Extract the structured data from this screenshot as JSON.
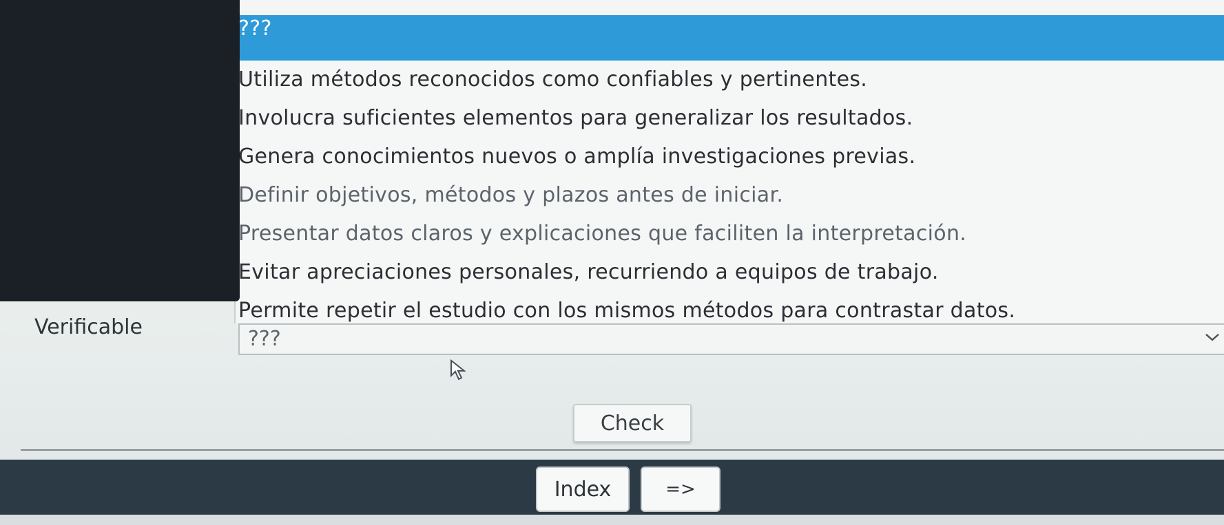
{
  "dropdown": {
    "selected_option": "???",
    "options": [
      "Utiliza métodos reconocidos como confiables y pertinentes.",
      "Involucra suficientes elementos para generalizar los resultados.",
      "Genera conocimientos nuevos o amplía investigaciones previas.",
      "Definir objetivos, métodos y plazos antes de iniciar.",
      "Presentar datos claros y explicaciones que faciliten la interpretación.",
      "Evitar apreciaciones personales, recurriendo a equipos de trabajo.",
      "Permite repetir el estudio con los mismos métodos para contrastar datos."
    ]
  },
  "question": {
    "label": "Verificable",
    "select_value": "???"
  },
  "buttons": {
    "check": "Check",
    "index": "Index",
    "next": "=>"
  },
  "colors": {
    "highlight": "#2f9ad8",
    "footer": "#2b3a44"
  }
}
